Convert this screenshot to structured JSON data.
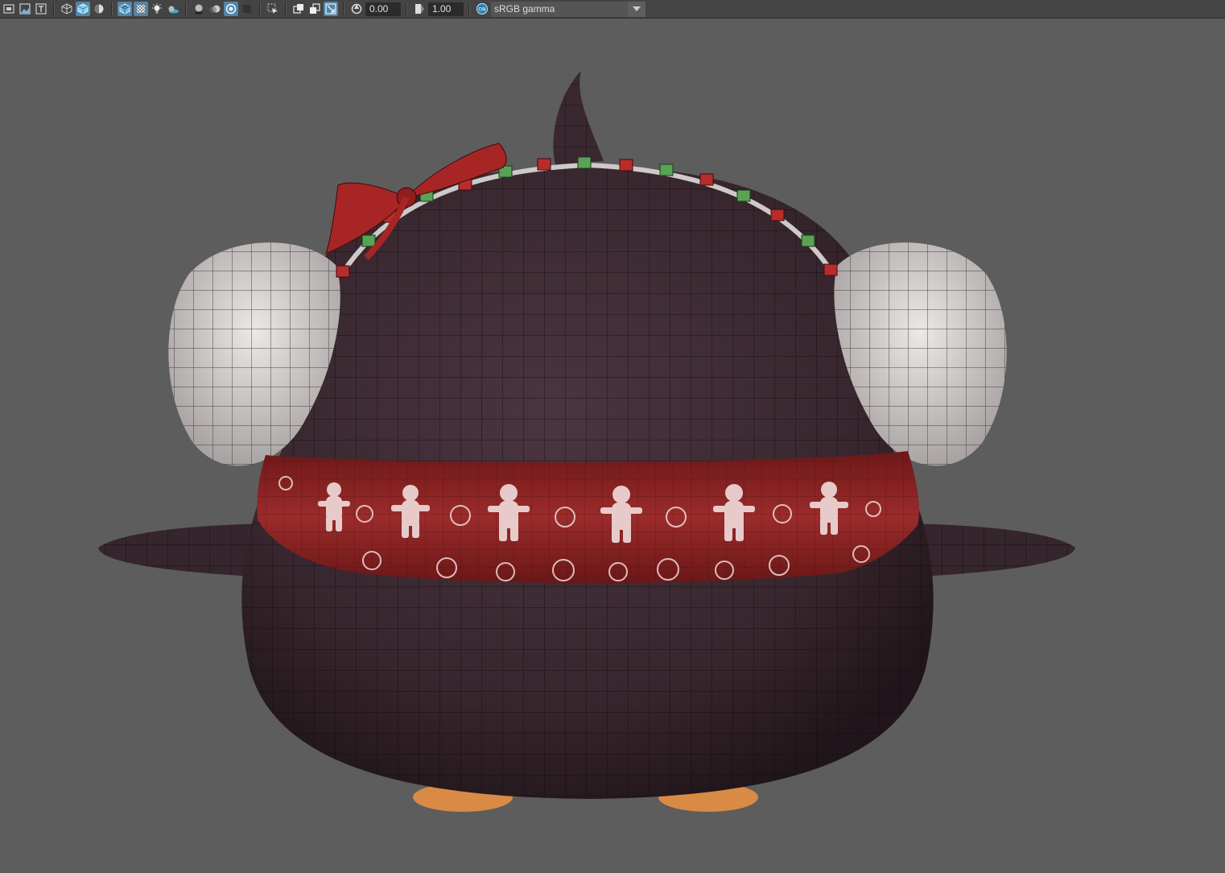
{
  "toolbar": {
    "icons": [
      "select-camera-icon",
      "image-plane-icon",
      "two-d-pan-icon",
      "wireframe-icon",
      "smooth-shade-icon",
      "shade-selected-icon",
      "wireframe-on-shaded-icon",
      "xray-icon",
      "use-default-lights-icon",
      "shadows-icon",
      "ambient-occlusion-icon",
      "motion-blur-icon",
      "anti-aliasing-icon",
      "depth-of-field-icon",
      "isolate-select-icon",
      "xray-joints-icon",
      "xray-active-icon",
      "backface-icon",
      "exposure-icon",
      "gamma-icon",
      "color-management-on-icon"
    ],
    "exposure_value": "0.00",
    "gamma_value": "1.00",
    "color_space": "sRGB gamma"
  },
  "colors": {
    "viewport_bg": "#5d5d5d",
    "body": "#3b2a31",
    "scarf": "#8e2626",
    "earmuff": "#d5d1d0",
    "active_toggle": "#5285a6"
  }
}
